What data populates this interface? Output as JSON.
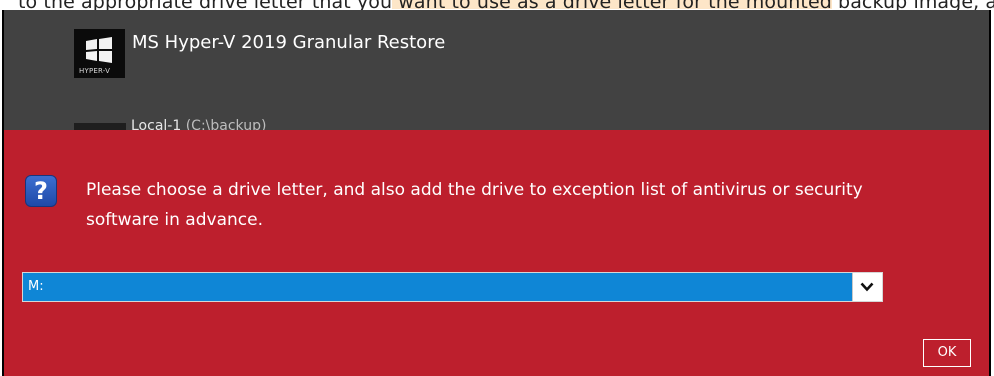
{
  "top_strip": {
    "text": "to the appropriate drive letter that you want to use as a drive letter for the mounted backup image, and then click OK to begin."
  },
  "app": {
    "logo_caption": "HYPER-V",
    "title": "MS Hyper-V 2019 Granular Restore",
    "second_row_label": "Local-1",
    "second_row_sub": "(C:\\backup)"
  },
  "dialog": {
    "icon": "question-icon",
    "message": "Please choose a drive letter, and also add the drive to exception list of antivirus or security software in advance.",
    "drive_select": {
      "selected": "M:"
    },
    "ok_label": "OK"
  },
  "colors": {
    "app_background": "#424242",
    "dialog_background": "#bd1f2d",
    "select_background": "#0f86d6",
    "icon_blue": "#2c5cc5"
  }
}
